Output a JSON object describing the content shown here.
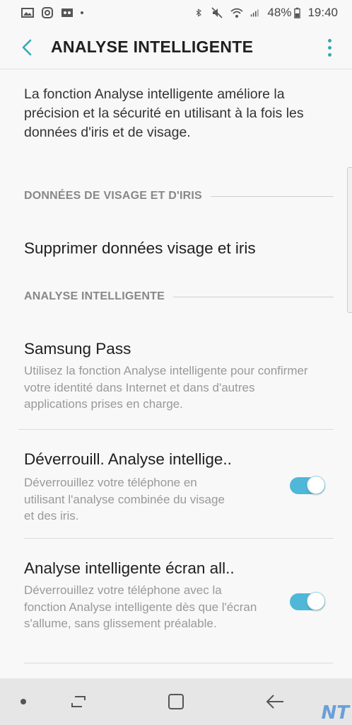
{
  "status_bar": {
    "battery_percent": "48%",
    "time": "19:40",
    "icons_left": [
      "gallery-icon",
      "instagram-icon",
      "voicemail-icon",
      "dot-icon"
    ],
    "icons_right": [
      "bluetooth-icon",
      "mute-icon",
      "wifi-icon",
      "signal-icon",
      "battery-icon"
    ]
  },
  "app_bar": {
    "title": "ANALYSE INTELLIGENTE",
    "back_icon": "chevron-left-icon",
    "more_icon": "more-vertical-icon",
    "accent_color": "#3aa6b6"
  },
  "intro_text": "La fonction Analyse intelligente améliore la précision et la sécurité en utilisant à la fois les données d'iris et de visage.",
  "sections": [
    {
      "header": "DONNÉES DE VISAGE ET D'IRIS",
      "items": [
        {
          "title": "Supprimer données visage et iris"
        }
      ]
    },
    {
      "header": "ANALYSE INTELLIGENTE",
      "items": [
        {
          "title": "Samsung Pass",
          "description": "Utilisez la fonction Analyse intelligente pour confirmer votre identité dans Internet et dans d'autres applications prises en charge."
        },
        {
          "title": "Déverrouill. Analyse intellige..",
          "description": "Déverrouillez votre téléphone en utilisant l'analyse combinée du visage et des iris.",
          "toggle_on": true
        },
        {
          "title": "Analyse intelligente écran all..",
          "description": "Déverrouillez votre téléphone avec la fonction Analyse intelligente dès que l'écran s'allume, sans glissement préalable.",
          "toggle_on": true
        }
      ]
    }
  ],
  "nav_bar": {
    "icons": [
      "dot-icon",
      "recents-icon",
      "home-icon",
      "back-arrow-icon"
    ]
  },
  "watermark": "NT",
  "colors": {
    "toggle_on": "#4fb8d8",
    "background": "#f8f8f8",
    "section_header": "#888888",
    "description": "#999999"
  }
}
